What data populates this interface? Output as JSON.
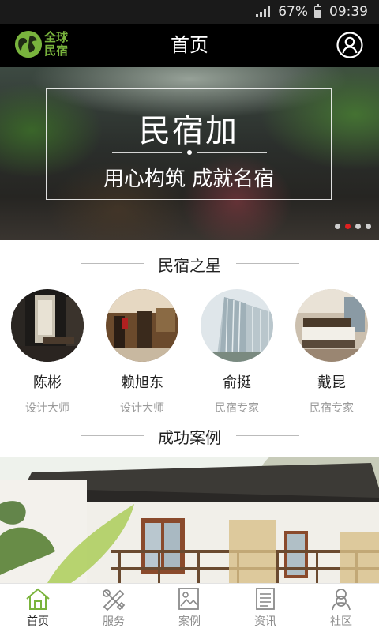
{
  "status_bar": {
    "battery": "67%",
    "time": "09:39",
    "battery_level": 0.67
  },
  "header": {
    "logo_line1": "全球",
    "logo_line2": "民宿",
    "title": "首页"
  },
  "banner": {
    "title": "民宿加",
    "subtitle": "用心构筑 成就名宿",
    "slide_count": 4,
    "active_slide": 2
  },
  "sections": {
    "stars_title": "民宿之星",
    "cases_title": "成功案例"
  },
  "stars": [
    {
      "name": "陈彬",
      "role": "设计大师"
    },
    {
      "name": "赖旭东",
      "role": "设计大师"
    },
    {
      "name": "俞挺",
      "role": "民宿专家"
    },
    {
      "name": "戴昆",
      "role": "民宿专家"
    }
  ],
  "tabs": [
    {
      "label": "首页",
      "icon": "home-icon",
      "active": true
    },
    {
      "label": "服务",
      "icon": "tools-icon",
      "active": false
    },
    {
      "label": "案例",
      "icon": "picture-icon",
      "active": false
    },
    {
      "label": "资讯",
      "icon": "news-icon",
      "active": false
    },
    {
      "label": "社区",
      "icon": "community-icon",
      "active": false
    }
  ],
  "colors": {
    "brand_green": "#79b43d",
    "active_dot": "#e02020",
    "header_bg": "#000000"
  }
}
